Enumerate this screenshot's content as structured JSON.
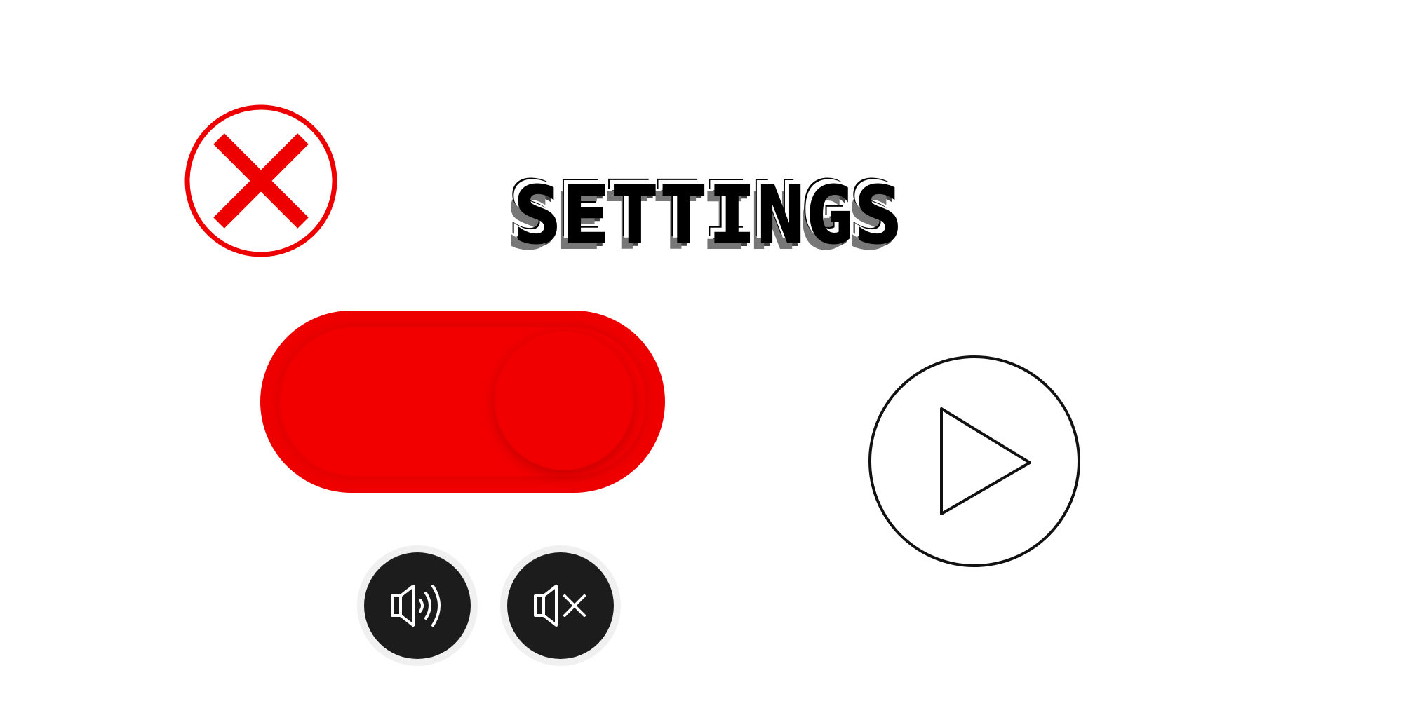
{
  "title": "SETTINGS",
  "icons": {
    "close": "close-icon",
    "play": "play-icon",
    "sound_on": "speaker-on-icon",
    "sound_off": "speaker-mute-icon"
  },
  "toggle": {
    "state": "on"
  },
  "colors": {
    "accent_red": "#ee0000",
    "sound_button_bg": "#1c1c1c",
    "outline": "#000000",
    "background": "#ffffff"
  }
}
